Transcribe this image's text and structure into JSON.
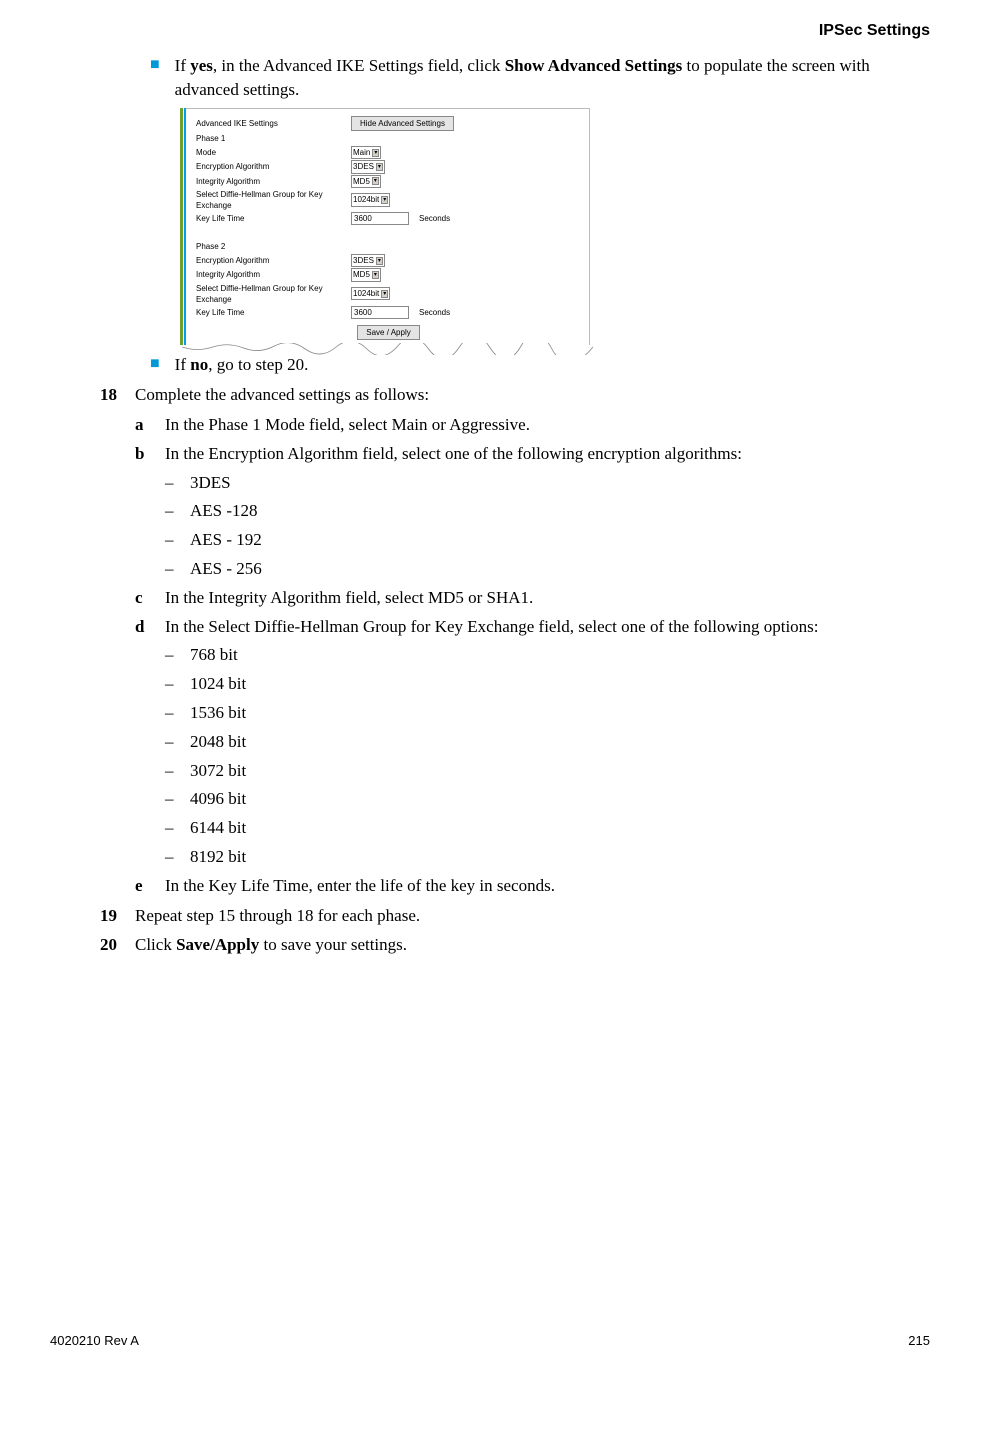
{
  "header": {
    "title": "IPSec Settings"
  },
  "intro_bullets": [
    {
      "pre": "If ",
      "bold1": "yes",
      "mid": ", in the Advanced IKE Settings field, click ",
      "bold2": "Show Advanced Settings",
      "post": " to populate the screen with advanced settings."
    }
  ],
  "figure": {
    "title": "Advanced IKE Settings",
    "hide_btn": "Hide Advanced Settings",
    "phase1_label": "Phase 1",
    "phase2_label": "Phase 2",
    "mode_label": "Mode",
    "enc_label": "Encryption Algorithm",
    "int_label": "Integrity Algorithm",
    "dh_label": "Select Diffie-Hellman Group for Key Exchange",
    "klt_label": "Key Life Time",
    "mode_val": "Main",
    "enc_val": "3DES",
    "int_val": "MD5",
    "dh_val": "1024bit",
    "klt_val": "3600",
    "seconds": "Seconds",
    "save_btn": "Save / Apply"
  },
  "post_bullet": {
    "pre": "If ",
    "bold1": "no",
    "post": ", go to step 20."
  },
  "steps": {
    "18": {
      "num": "18",
      "text": "Complete the advanced settings as follows:"
    },
    "19": {
      "num": "19",
      "text": "Repeat step 15 through 18 for each phase."
    },
    "20": {
      "num": "20",
      "pre": "Click ",
      "bold": "Save/Apply",
      "post": " to save your settings."
    }
  },
  "sub": {
    "a": {
      "l": "a",
      "text": "In the Phase 1 Mode field, select Main or Aggressive."
    },
    "b": {
      "l": "b",
      "text": "In the Encryption Algorithm field, select one of the following encryption algorithms:"
    },
    "c": {
      "l": "c",
      "text": "In the Integrity Algorithm field, select MD5 or SHA1."
    },
    "d": {
      "l": "d",
      "text": "In the Select Diffie-Hellman Group for Key Exchange field, select one of the following options:"
    },
    "e": {
      "l": "e",
      "text": "In the Key Life Time, enter the life of the key in seconds."
    }
  },
  "enc_opts": [
    "3DES",
    "AES -128",
    "AES - 192",
    "AES - 256"
  ],
  "dh_opts": [
    "768 bit",
    "1024 bit",
    "1536 bit",
    "2048 bit",
    "3072 bit",
    "4096 bit",
    "6144 bit",
    "8192 bit"
  ],
  "footer": {
    "left": "4020210 Rev A",
    "right": "215"
  },
  "dash": "–"
}
